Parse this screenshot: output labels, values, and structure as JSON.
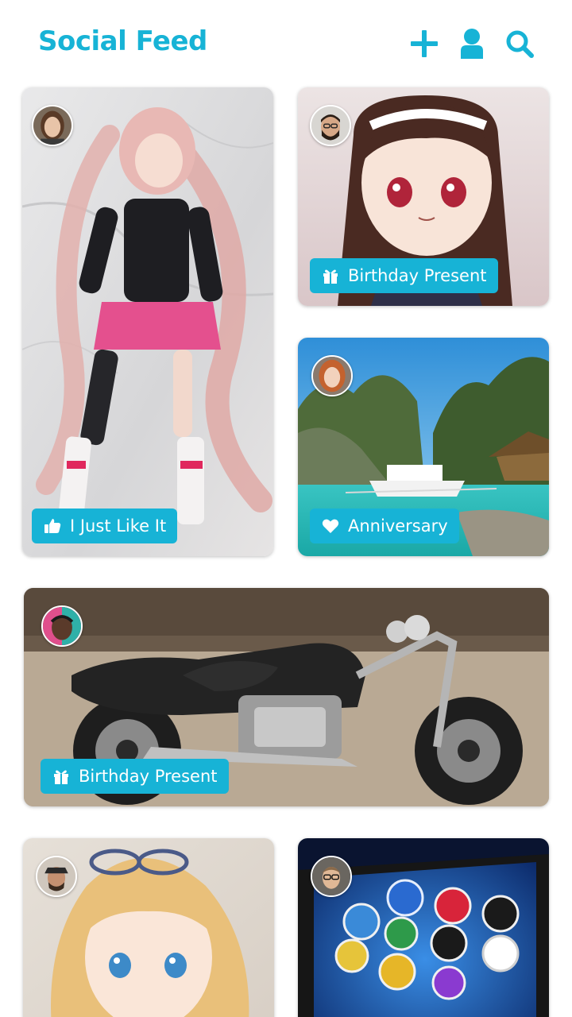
{
  "app": {
    "title": "Social Feed",
    "accent_color": "#17b3d6"
  },
  "header": {
    "actions": [
      {
        "icon": "plus-icon"
      },
      {
        "icon": "user-icon"
      },
      {
        "icon": "search-icon"
      }
    ]
  },
  "feed": {
    "posts": [
      {
        "subject": "anime-figure-pink-hair",
        "tag": {
          "icon": "thumbs-up-icon",
          "label": "I Just Like It"
        }
      },
      {
        "subject": "chibi-figure-dark-hair",
        "tag": {
          "icon": "gift-icon",
          "label": "Birthday Present"
        }
      },
      {
        "subject": "tropical-lagoon-boat",
        "tag": {
          "icon": "heart-icon",
          "label": "Anniversary"
        }
      },
      {
        "subject": "black-motorcycle",
        "tag": {
          "icon": "gift-icon",
          "label": "Birthday Present"
        }
      },
      {
        "subject": "anime-figure-blonde-hair",
        "tag": {
          "icon": "",
          "label": ""
        }
      },
      {
        "subject": "handheld-game-console",
        "tag": {
          "icon": "",
          "label": ""
        }
      }
    ]
  }
}
